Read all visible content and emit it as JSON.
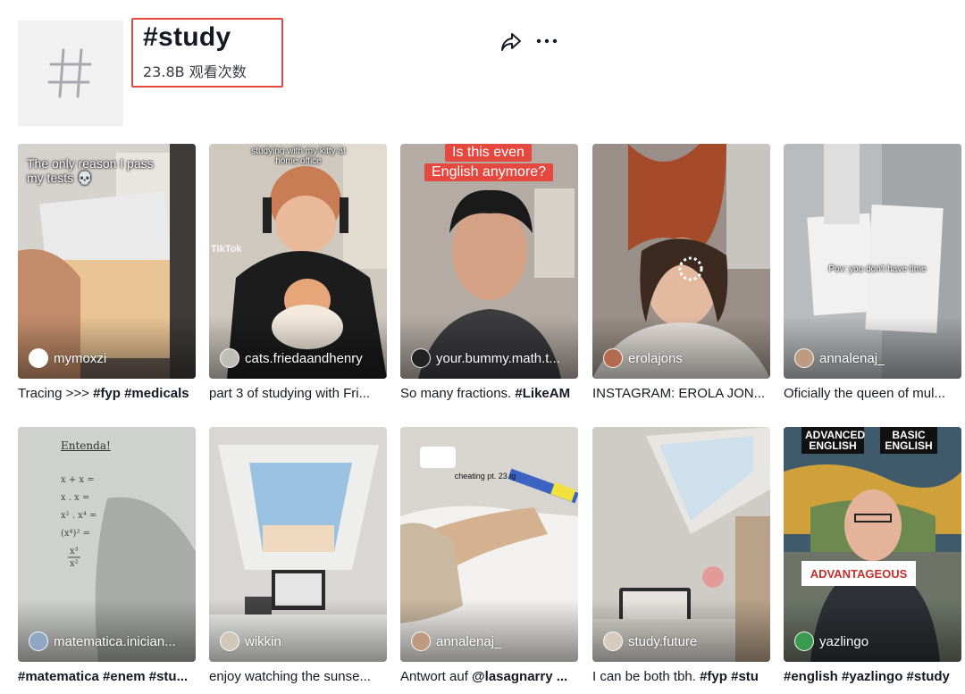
{
  "header": {
    "title": "#study",
    "views": "23.8B 观看次数",
    "avatar_icon": "hashtag-icon",
    "share_icon": "share-arrow-icon",
    "more_icon": "more-dots-icon"
  },
  "videos": [
    {
      "author": "mymoxzi",
      "caption_plain": "Tracing >>> ",
      "caption_bold": "#fyp #medicals",
      "overlay": "The only reason I pass my tests 💀"
    },
    {
      "author": "cats.friedaandhenry",
      "caption_plain": "part 3 of studying with Fri...",
      "caption_bold": "",
      "overlay": "studying with my kitty at home office",
      "watermark": "TikTok"
    },
    {
      "author": "your.bummy.math.t...",
      "caption_plain": "So many fractions. ",
      "caption_bold": "#LikeAM",
      "overlay_line1": "Is this even",
      "overlay_line2": "English anymore?"
    },
    {
      "author": "erolajons",
      "caption_plain": "INSTAGRAM: EROLA JON...",
      "caption_bold": ""
    },
    {
      "author": "annalenaj_",
      "caption_plain": "Oficially the queen of mul...",
      "caption_bold": "",
      "overlay": "Pov: you don't have time"
    },
    {
      "author": "matematica.inician...",
      "caption_plain": "",
      "caption_bold": "#matematica #enem #stu...",
      "overlay": "Entenda!"
    },
    {
      "author": "wikkin",
      "caption_plain": "enjoy watching the sunse...",
      "caption_bold": ""
    },
    {
      "author": "annalenaj_",
      "caption_plain": "Antwort auf ",
      "caption_bold": "@lasagnarry ...",
      "overlay": "cheating pt. 23 ig"
    },
    {
      "author": "study.future",
      "caption_plain": "I can be both tbh. ",
      "caption_bold": "#fyp #stu"
    },
    {
      "author": "yazlingo",
      "caption_plain": "",
      "caption_bold": "#english #yazlingo #study",
      "tag_left": "ADVANCED ENGLISH",
      "tag_right": "BASIC ENGLISH",
      "sign": "ADVANTAGEOUS"
    }
  ]
}
